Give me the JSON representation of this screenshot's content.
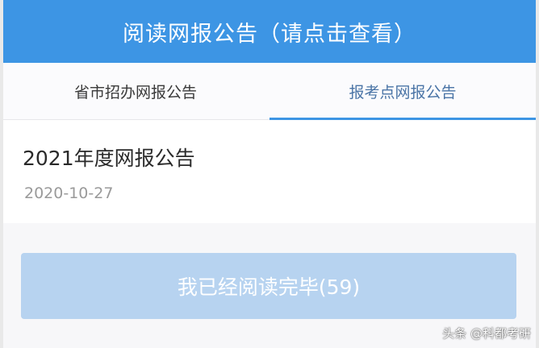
{
  "header": {
    "title": "阅读网报公告（请点击查看）"
  },
  "tabs": [
    {
      "label": "省市招办网报公告",
      "active": false
    },
    {
      "label": "报考点网报公告",
      "active": true
    }
  ],
  "announcement": {
    "title": "2021年度网报公告",
    "date": "2020-10-27"
  },
  "confirm_button": {
    "label": "我已经阅读完毕(59)"
  },
  "watermark": {
    "text": "头条 @科都考研"
  },
  "colors": {
    "header_bg": "#3d95e4",
    "active_tab_text": "#4a74a6",
    "disabled_button_bg": "#b7d3f0"
  }
}
